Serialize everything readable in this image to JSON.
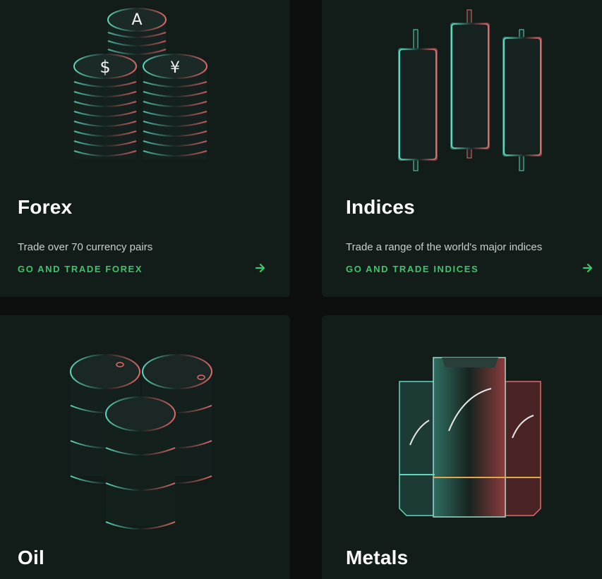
{
  "cards": [
    {
      "title": "Forex",
      "description": "Trade over 70 currency pairs",
      "cta": "GO AND TRADE FOREX",
      "illustration": "coin-stacks-illustration"
    },
    {
      "title": "Indices",
      "description": "Trade a range of the world's major indices",
      "cta": "GO AND TRADE INDICES",
      "illustration": "candlestick-illustration"
    },
    {
      "title": "Oil",
      "illustration": "oil-barrels-illustration"
    },
    {
      "title": "Metals",
      "illustration": "metal-bars-illustration"
    }
  ],
  "colors": {
    "background": "#0d0e0e",
    "card": "#121d19",
    "accent_green": "#3fc46b",
    "glow_teal": "#5fd8c0",
    "glow_red": "#e06a6a"
  },
  "icons": {
    "forex_coin_symbols": [
      "A",
      "$",
      "¥"
    ],
    "arrow": "arrow-right-icon"
  }
}
